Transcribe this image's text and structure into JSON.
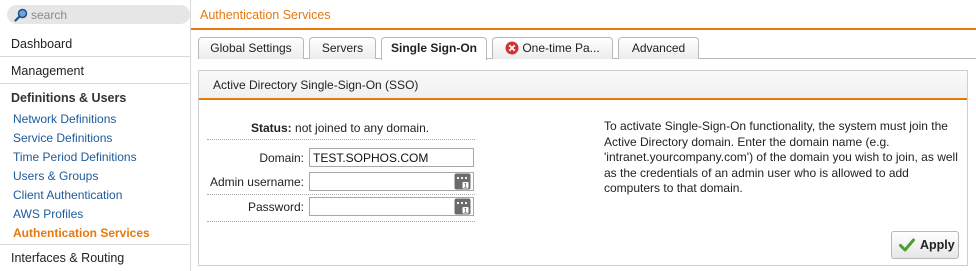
{
  "search": {
    "placeholder": "search"
  },
  "sidebar": {
    "top_items": [
      "Dashboard",
      "Management"
    ],
    "section": "Definitions & Users",
    "sub_items": [
      "Network Definitions",
      "Service Definitions",
      "Time Period Definitions",
      "Users & Groups",
      "Client Authentication",
      "AWS Profiles",
      "Authentication Services"
    ],
    "bottom_item": "Interfaces & Routing"
  },
  "header": {
    "title": "Authentication Services"
  },
  "tabs": [
    "Global Settings",
    "Servers",
    "Single Sign-On",
    "One-time Pa...",
    "Advanced"
  ],
  "panel": {
    "title": "Active Directory Single-Sign-On (SSO)",
    "status_label": "Status:",
    "status_value": "not joined to any domain.",
    "domain_label": "Domain:",
    "domain_value": "TEST.SOPHOS.COM",
    "admin_label": "Admin username:",
    "admin_value": "",
    "password_label": "Password:",
    "password_value": "",
    "help_text": "To activate Single-Sign-On functionality, the system must join the Active Directory domain. Enter the domain name (e.g. 'intranet.yourcompany.com') of the domain you wish to join, as well as the credentials of an admin user who is allowed to add computers to that domain.",
    "apply_label": "Apply"
  },
  "colors": {
    "accent": "#e8780c",
    "link": "#1d5a9b",
    "error": "#d23232",
    "ok": "#4a9e2a"
  },
  "icons": {
    "search": "search-icon",
    "error": "error-icon",
    "password_tool": "password-generator-icon",
    "apply": "checkmark-icon"
  }
}
